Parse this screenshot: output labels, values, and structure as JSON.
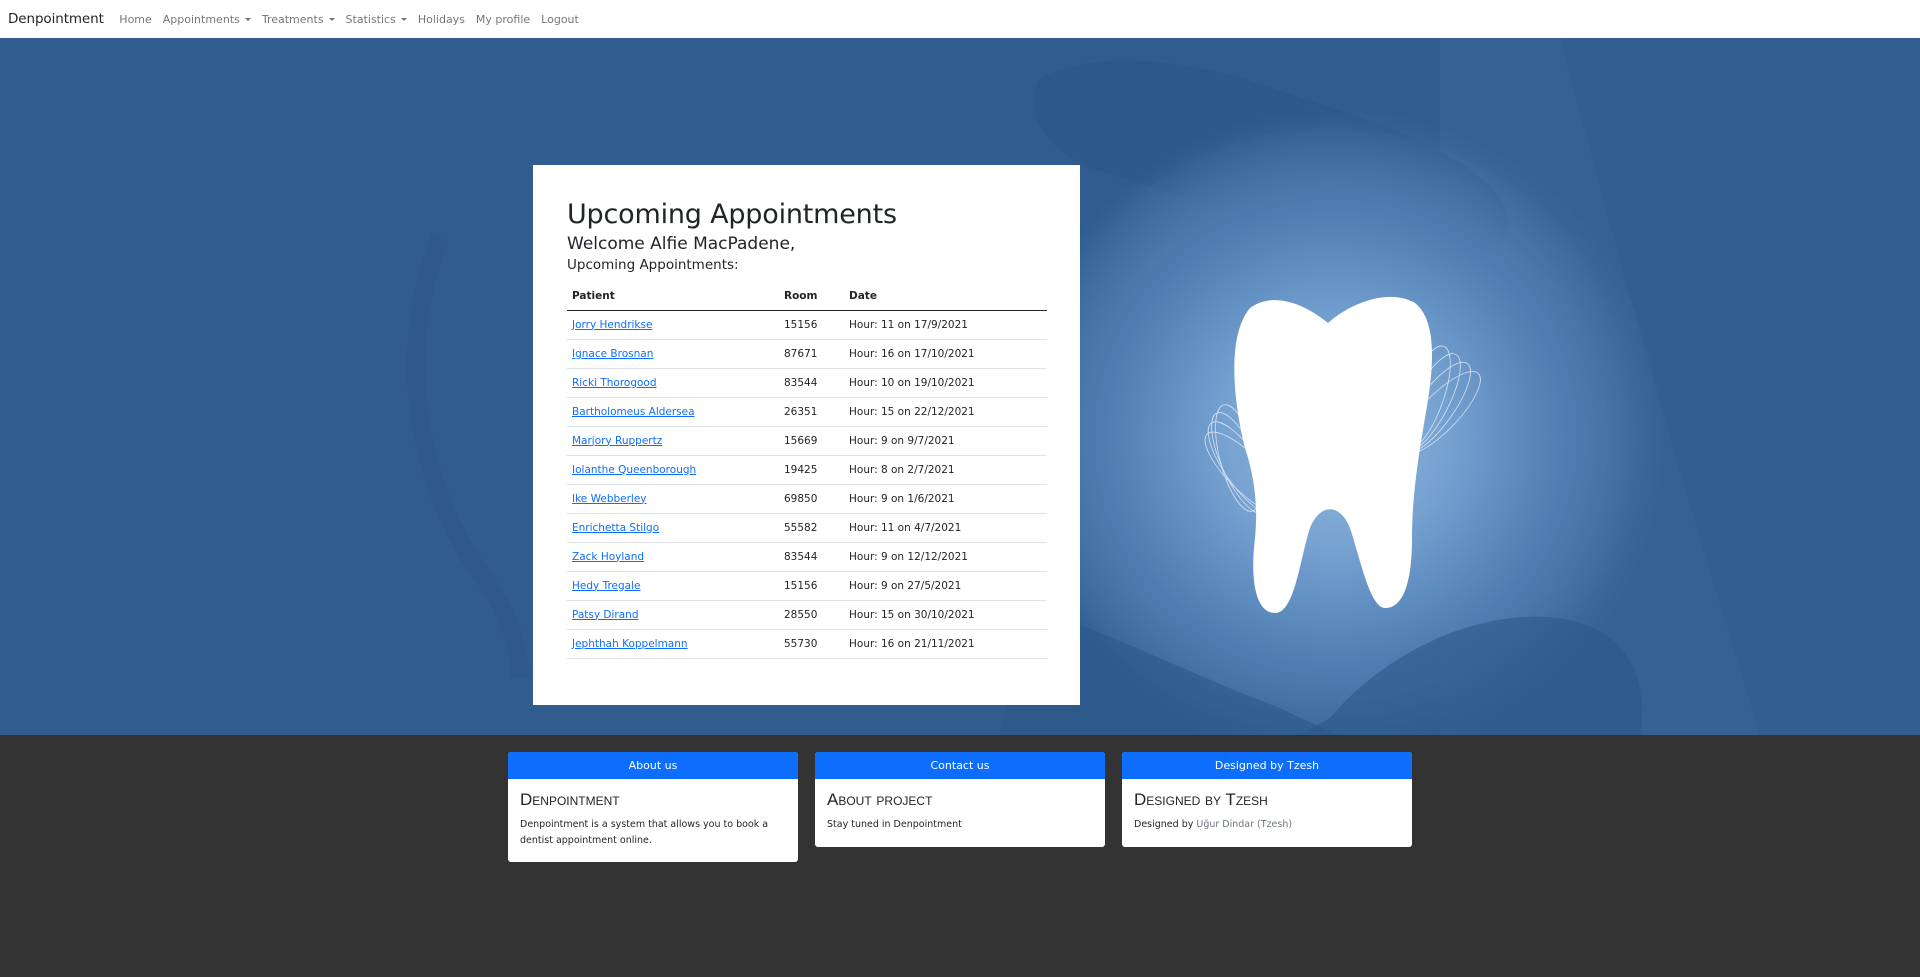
{
  "navbar": {
    "brand": "Denpointment",
    "items": [
      {
        "label": "Home",
        "dropdown": false
      },
      {
        "label": "Appointments",
        "dropdown": true
      },
      {
        "label": "Treatments",
        "dropdown": true
      },
      {
        "label": "Statistics",
        "dropdown": true
      },
      {
        "label": "Holidays",
        "dropdown": false
      },
      {
        "label": "My profile",
        "dropdown": false
      },
      {
        "label": "Logout",
        "dropdown": false
      }
    ]
  },
  "hero": {
    "illustration": "tooth-icon",
    "colors": {
      "background": "#305d8e",
      "glow": "#8db4dd"
    }
  },
  "appointments": {
    "title": "Upcoming Appointments",
    "welcome": "Welcome Alfie MacPadene,",
    "subtitle": "Upcoming Appointments:",
    "columns": [
      "Patient",
      "Room",
      "Date"
    ],
    "rows": [
      {
        "patient": "Jorry Hendrikse",
        "room": "15156",
        "date": "Hour: 11 on 17/9/2021"
      },
      {
        "patient": "Ignace Brosnan",
        "room": "87671",
        "date": "Hour: 16 on 17/10/2021"
      },
      {
        "patient": "Ricki Thorogood",
        "room": "83544",
        "date": "Hour: 10 on 19/10/2021"
      },
      {
        "patient": "Bartholomeus Aldersea",
        "room": "26351",
        "date": "Hour: 15 on 22/12/2021"
      },
      {
        "patient": "Marjory Ruppertz",
        "room": "15669",
        "date": "Hour: 9 on 9/7/2021"
      },
      {
        "patient": "Iolanthe Queenborough",
        "room": "19425",
        "date": "Hour: 8 on 2/7/2021"
      },
      {
        "patient": "Ike Webberley",
        "room": "69850",
        "date": "Hour: 9 on 1/6/2021"
      },
      {
        "patient": "Enrichetta Stilgo",
        "room": "55582",
        "date": "Hour: 11 on 4/7/2021"
      },
      {
        "patient": "Zack Hoyland",
        "room": "83544",
        "date": "Hour: 9 on 12/12/2021"
      },
      {
        "patient": "Hedy Tregale",
        "room": "15156",
        "date": "Hour: 9 on 27/5/2021"
      },
      {
        "patient": "Patsy Dirand",
        "room": "28550",
        "date": "Hour: 15 on 30/10/2021"
      },
      {
        "patient": "Jephthah Koppelmann",
        "room": "55730",
        "date": "Hour: 16 on 21/11/2021"
      }
    ]
  },
  "footer": {
    "cards": [
      {
        "header": "About us",
        "title": "Denpointment",
        "text": "Denpointment is a system that allows you to book a dentist appointment online."
      },
      {
        "header": "Contact us",
        "title": "About project",
        "text": "Stay tuned in Denpointment"
      },
      {
        "header": "Designed by Tzesh",
        "title": "Designed by Tzesh",
        "text_prefix": "Designed by ",
        "text_muted": "Uğur Dindar (Tzesh)"
      }
    ],
    "colors": {
      "background": "#333333",
      "card_header": "#0d6efd"
    }
  }
}
